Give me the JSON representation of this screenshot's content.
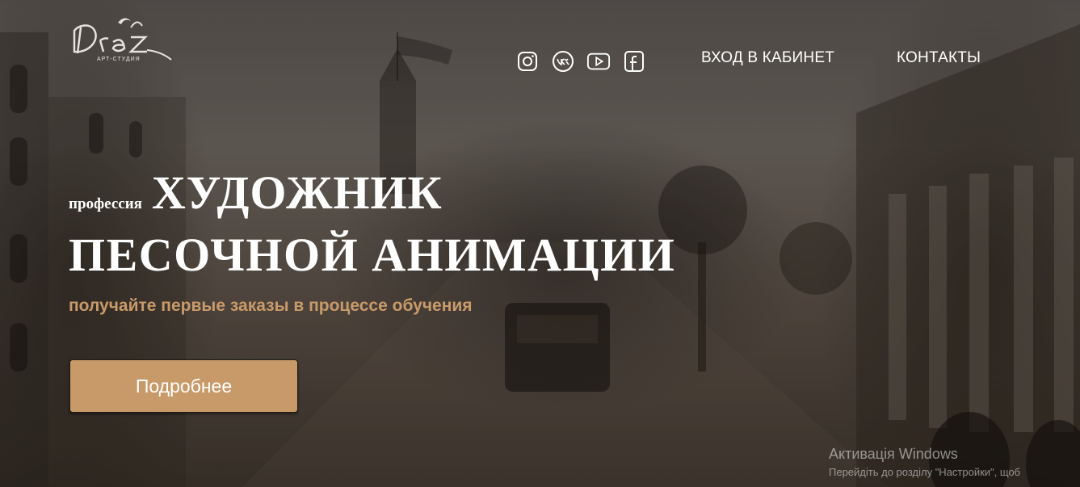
{
  "header": {
    "logo_text": "Diaz",
    "logo_subtext": "АРТ-СТУДИЯ",
    "social": [
      {
        "icon": "instagram-icon"
      },
      {
        "icon": "vk-icon"
      },
      {
        "icon": "youtube-icon"
      },
      {
        "icon": "facebook-icon"
      }
    ],
    "nav": {
      "login": "ВХОД В КАБИНЕТ",
      "contacts": "КОНТАКТЫ"
    }
  },
  "hero": {
    "prefix": "профессия",
    "title_line1": "ХУДОЖНИК",
    "title_line2": "ПЕСОЧНОЙ АНИМАЦИИ",
    "subtitle": "получайте первые заказы в процессе обучения",
    "cta_label": "Подробнее"
  },
  "windows_watermark": {
    "title": "Активація Windows",
    "text": "Перейдіть до розділу \"Настройки\", щоб"
  },
  "colors": {
    "accent": "#c99a69",
    "subtitle": "#c99a6a"
  }
}
